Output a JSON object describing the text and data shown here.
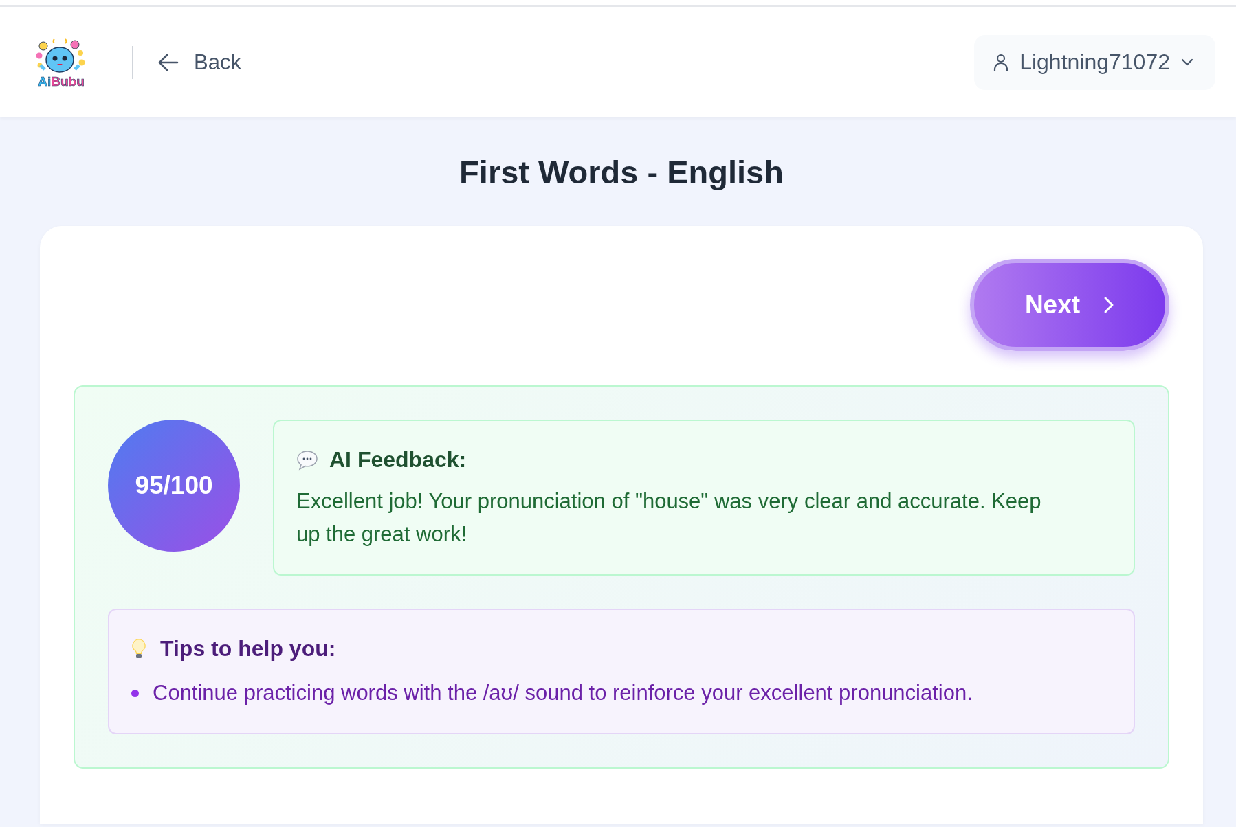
{
  "header": {
    "logo": {
      "parts": [
        {
          "text": "Ai",
          "color": "#38bdf8"
        },
        {
          "text": "Bubu",
          "color": "#ec4899"
        }
      ]
    },
    "back": {
      "label": "Back"
    },
    "user_menu": {
      "name": "Lightning71072"
    }
  },
  "title": "First Words - English",
  "next_button": {
    "label": "Next"
  },
  "result": {
    "score": "95/100",
    "feedback": {
      "heading": "AI Feedback:",
      "text": "Excellent job! Your pronunciation of \"house\" was very clear and accurate. Keep up the great work!"
    },
    "tips": {
      "heading": "Tips to help you:",
      "items": [
        "Continue practicing words with the /aʊ/ sound to reinforce your excellent pronunciation."
      ]
    }
  }
}
